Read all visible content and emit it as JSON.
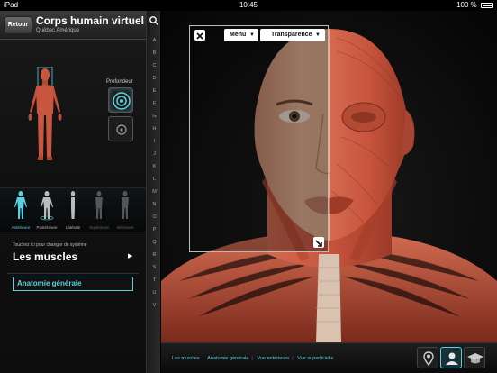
{
  "status_bar": {
    "device": "iPad",
    "time": "10:45",
    "battery": "100 %"
  },
  "header": {
    "back_label": "Retour",
    "title": "Corps humain virtuel",
    "subtitle": "Québec Amérique"
  },
  "depth": {
    "label": "Profondeur"
  },
  "systems": [
    {
      "label": "Antérieure",
      "selected": true
    },
    {
      "label": "Postérieure",
      "selected": false
    },
    {
      "label": "Latérale",
      "selected": false
    },
    {
      "label": "Supérieure",
      "selected": false
    },
    {
      "label": "Inférieure",
      "selected": false
    }
  ],
  "system_panel": {
    "hint": "Touchez ici pour changer de système",
    "name": "Les muscles",
    "general_button": "Anatomie générale"
  },
  "index_letters": [
    "A",
    "B",
    "C",
    "D",
    "E",
    "F",
    "G",
    "H",
    "I",
    "J",
    "K",
    "L",
    "M",
    "N",
    "O",
    "P",
    "Q",
    "R",
    "S",
    "T",
    "U",
    "V"
  ],
  "overlay": {
    "menu_label": "Menu",
    "transparency_label": "Transparence"
  },
  "breadcrumbs": [
    "Les muscles",
    "Anatomie générale",
    "Vue antérieure",
    "Vue superficielle"
  ],
  "colors": {
    "accent": "#5cd0e0",
    "muscle": "#c8553d",
    "skin": "#e0a888"
  },
  "icons": [
    "search-icon",
    "close-icon",
    "resize-icon",
    "pin-icon",
    "person-icon",
    "graduation-cap-icon"
  ]
}
